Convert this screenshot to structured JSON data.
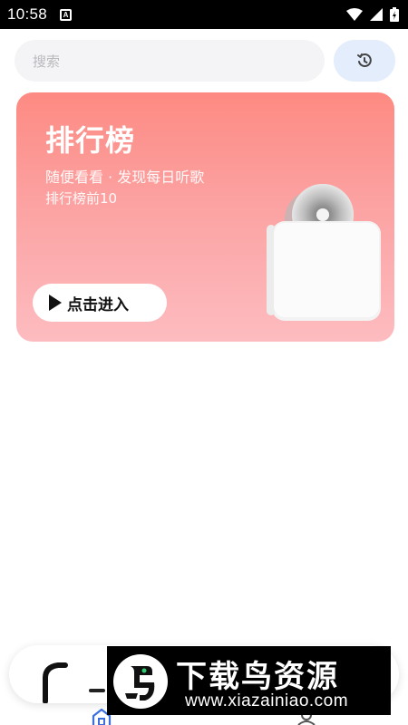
{
  "status_bar": {
    "time": "10:58",
    "notification_icon": "A"
  },
  "search": {
    "placeholder": "搜索",
    "history_icon": "history-icon"
  },
  "ranking_card": {
    "title": "排行榜",
    "subtitle": "随便看看 · 发现每日听歌",
    "caption": "排行榜前10",
    "enter_label": "点击进入",
    "gradient_top": "#fd8a82",
    "gradient_bottom": "#fdbcc0"
  },
  "bottom_nav": {
    "items": [
      {
        "icon": "home-icon"
      },
      {
        "icon": "user-icon"
      }
    ],
    "accent": "#3b6fe0"
  },
  "watermark": {
    "title": "下载鸟资源",
    "url": "www.xiazainiao.com"
  }
}
